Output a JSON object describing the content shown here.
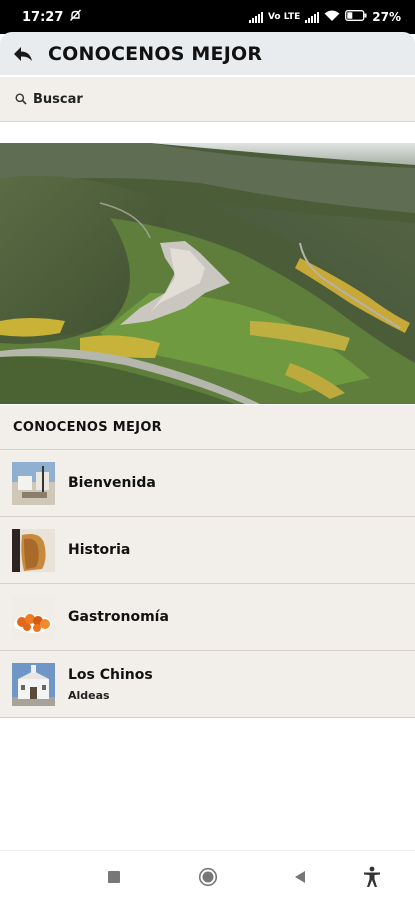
{
  "status_bar": {
    "time": "17:27",
    "network": "Vo LTE",
    "battery": "27"
  },
  "header": {
    "title": "CONOCENOS MEJOR",
    "back_icon": "back-arrow-icon"
  },
  "search": {
    "label": "Buscar",
    "icon": "search-icon"
  },
  "hero": {
    "alt": "aerial-valley-village-photo"
  },
  "section": {
    "label": "CONOCENOS MEJOR"
  },
  "items": [
    {
      "title": "Bienvenida",
      "subtitle": ""
    },
    {
      "title": "Historia",
      "subtitle": ""
    },
    {
      "title": "Gastronomía",
      "subtitle": ""
    },
    {
      "title": "Los Chinos",
      "subtitle": "Aldeas"
    }
  ],
  "nav": {
    "icons": [
      "square-nav-icon",
      "circle-home-icon",
      "triangle-back-icon",
      "accessibility-icon"
    ]
  }
}
